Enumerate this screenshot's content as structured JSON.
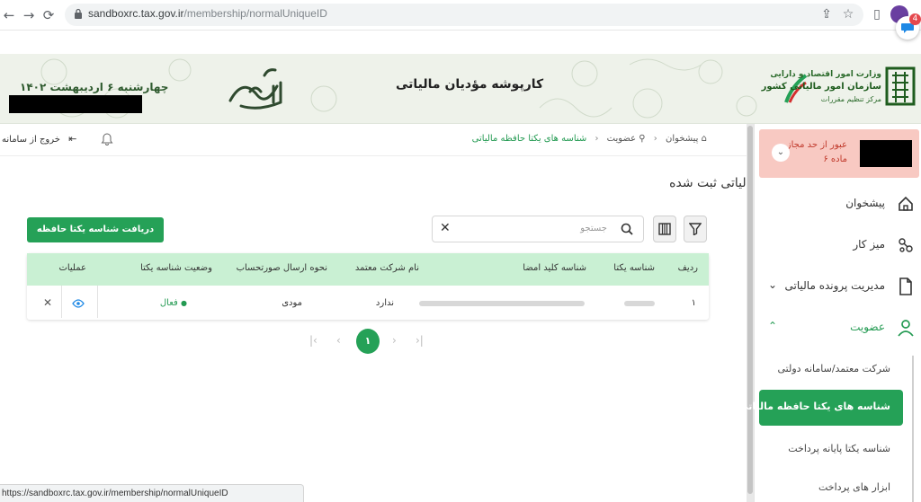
{
  "browser": {
    "url_host": "sandboxrc.tax.gov.ir",
    "url_path": "/membership/normalUniqueID",
    "profile_initial": "",
    "notification_count": "4",
    "status_url": "https://sandboxrc.tax.gov.ir/membership/normalUniqueID"
  },
  "header": {
    "date": "چهارشنبه ۶ اردیبهشت ۱۴۰۲",
    "title": "کارپوشه مؤدیان مالیاتی",
    "ministry_line1": "وزارت امور اقتصاد و دارایی",
    "ministry_line2": "سازمان امور مالیاتی کشور",
    "ministry_line3": "مرکز تنظیم مقررات"
  },
  "topbar": {
    "logout_label": "خروج از سامانه",
    "breadcrumb": {
      "home": "پیشخوان",
      "membership": "عضویت",
      "current": "شناسه های یکتا حافظه مالیاتی"
    }
  },
  "page": {
    "title": "شناسه های یکتا حافظه مالیاتی ثبت شده",
    "receive_button": "دریافت شناسه یکتا حافظه مالیاتی",
    "search_placeholder": "جستجو"
  },
  "table": {
    "columns": [
      "ردیف",
      "شناسه یکتا",
      "شناسه کلید امضا",
      "نام شرکت معتمد",
      "نحوه ارسال صورتحساب",
      "وضعیت شناسه یکتا",
      "عملیات"
    ],
    "rows": [
      {
        "index": "۱",
        "company": "ندارد",
        "send_method": "مودی",
        "status": "فعال"
      }
    ]
  },
  "pagination": {
    "current": "۱"
  },
  "sidebar": {
    "alert_line1": "عبور از حد مجاز",
    "alert_line2": "ماده ۶",
    "items": [
      {
        "label": "پیشخوان"
      },
      {
        "label": "میز کار"
      },
      {
        "label": "مدیریت پرونده مالیاتی"
      },
      {
        "label": "عضویت"
      }
    ],
    "sub_items": [
      {
        "label": "شرکت معتمد/سامانه دولتی"
      },
      {
        "label": "شناسه های یکتا حافظه مالیاتی"
      },
      {
        "label": "شناسه یکتا پایانه پرداخت"
      },
      {
        "label": "ابزار های پرداخت"
      }
    ]
  },
  "colors": {
    "primary_green": "#25a157",
    "table_header": "#c9f0d3",
    "alert_bg": "#f8c9c2",
    "alert_text": "#c0392b"
  }
}
